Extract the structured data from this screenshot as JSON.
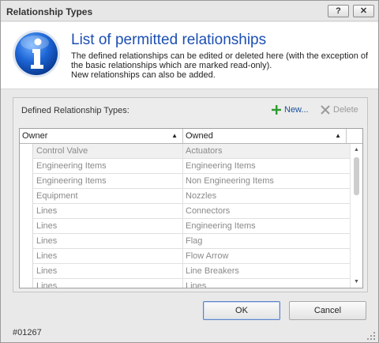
{
  "window": {
    "title": "Relationship Types",
    "help_label": "?",
    "close_label": "✕"
  },
  "header": {
    "title": "List of permitted relationships",
    "description_lines": [
      "The defined relationships can be edited or deleted here (with the exception of",
      "the basic relationships which are marked read-only).",
      "New relationships can also be added."
    ],
    "icon": "info-icon",
    "accent_color": "#1c4fb3"
  },
  "group": {
    "label": "Defined Relationship Types:",
    "new_label": "New...",
    "delete_label": "Delete",
    "new_icon": "plus-icon",
    "delete_icon": "cross-icon"
  },
  "grid": {
    "columns": [
      "Owner",
      "Owned"
    ],
    "rows": [
      {
        "owner": "Control Valve",
        "owned": "Actuators"
      },
      {
        "owner": "Engineering Items",
        "owned": "Engineering Items"
      },
      {
        "owner": "Engineering Items",
        "owned": "Non Engineering Items"
      },
      {
        "owner": "Equipment",
        "owned": "Nozzles"
      },
      {
        "owner": "Lines",
        "owned": "Connectors"
      },
      {
        "owner": "Lines",
        "owned": "Engineering Items"
      },
      {
        "owner": "Lines",
        "owned": "Flag"
      },
      {
        "owner": "Lines",
        "owned": "Flow Arrow"
      },
      {
        "owner": "Lines",
        "owned": "Line Breakers"
      },
      {
        "owner": "Lines",
        "owned": "Lines"
      }
    ]
  },
  "buttons": {
    "ok": "OK",
    "cancel": "Cancel"
  },
  "footer": {
    "code": "#01267"
  }
}
